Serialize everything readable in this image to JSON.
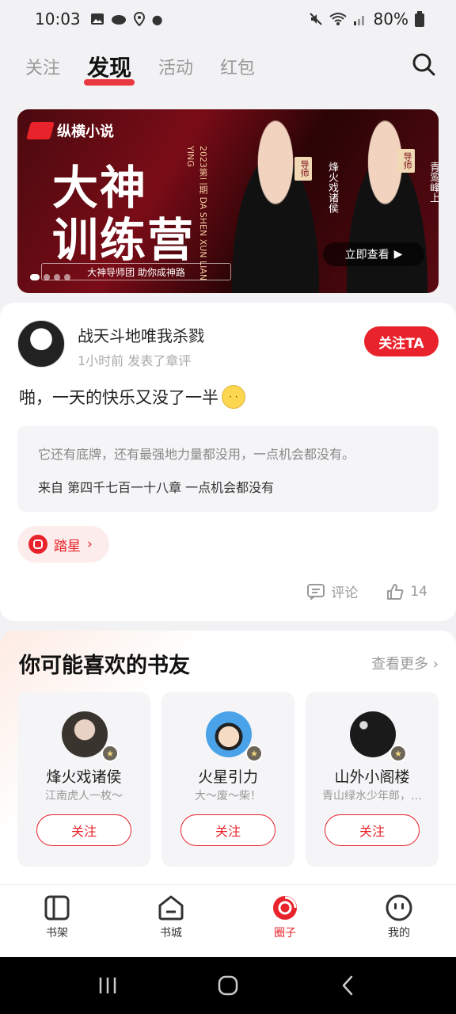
{
  "status_bar": {
    "time": "10:03",
    "battery": "80%"
  },
  "top_tabs": [
    {
      "label": "关注",
      "active": false
    },
    {
      "label": "发现",
      "active": true
    },
    {
      "label": "活动",
      "active": false
    },
    {
      "label": "红包",
      "active": false
    }
  ],
  "banner": {
    "brand": "纵横小说",
    "title_line1": "大神",
    "title_line2": "训练营",
    "subtitle": "大神导师团 助你成神路",
    "vertical_text": "2023第二期 DA SHEN XUN LIAN YING",
    "tag1": "导师",
    "name1": "烽火戏诸侯",
    "tag2": "导师",
    "name2": "青鸾峰上",
    "cta": "立即查看"
  },
  "post": {
    "username": "战天斗地唯我杀戮",
    "meta": "1小时前 发表了章评",
    "follow_label": "关注TA",
    "text": "啪，一天的快乐又没了一半",
    "quote": "它还有底牌，还有最强地力量都没用，一点机会都没有。",
    "source": "来自 第四千七百一十八章 一点机会都没有",
    "tag_label": "踏星",
    "comment_label": "评论",
    "like_count": "14"
  },
  "friends": {
    "title": "你可能喜欢的书友",
    "see_more": "查看更多",
    "cards": [
      {
        "name": "烽火戏诸侯",
        "desc": "江南虎人一枚～",
        "button": "关注"
      },
      {
        "name": "火星引力",
        "desc": "大～废～柴！",
        "button": "关注"
      },
      {
        "name": "山外小阁楼",
        "desc": "青山绿水少年郎，…",
        "button": "关注"
      }
    ]
  },
  "bottom_nav": [
    {
      "label": "书架",
      "active": false
    },
    {
      "label": "书城",
      "active": false
    },
    {
      "label": "圈子",
      "active": true
    },
    {
      "label": "我的",
      "active": false
    }
  ],
  "colors": {
    "accent": "#e8232b"
  }
}
